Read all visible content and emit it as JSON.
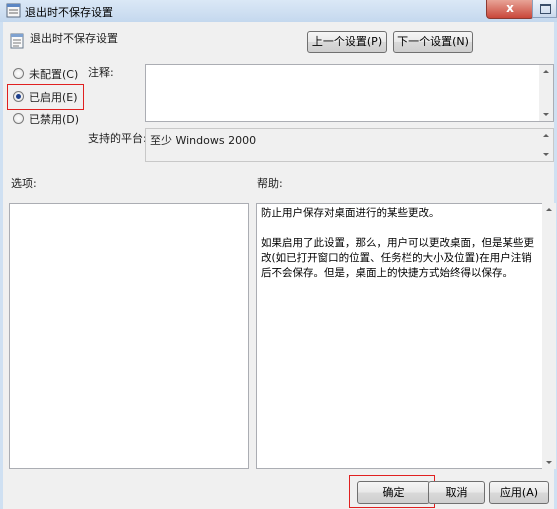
{
  "window": {
    "title": "退出时不保存设置",
    "close_label": "x"
  },
  "header": {
    "setting_title": "退出时不保存设置",
    "prev_button": "上一个设置(P)",
    "next_button": "下一个设置(N)"
  },
  "state": {
    "options": [
      {
        "label": "未配置(C)",
        "checked": false
      },
      {
        "label": "已启用(E)",
        "checked": true
      },
      {
        "label": "已禁用(D)",
        "checked": false
      }
    ]
  },
  "comment": {
    "label": "注释:",
    "value": ""
  },
  "platform": {
    "label": "支持的平台:",
    "value": "至少 Windows 2000"
  },
  "options_panel": {
    "label": "选项:"
  },
  "help_panel": {
    "label": "帮助:",
    "paragraphs": [
      "防止用户保存对桌面进行的某些更改。",
      "如果启用了此设置，那么，用户可以更改桌面，但是某些更改(如已打开窗口的位置、任务栏的大小及位置)在用户注销后不会保存。但是，桌面上的快捷方式始终得以保存。"
    ]
  },
  "footer": {
    "ok_button": "确定",
    "cancel_button": "取消",
    "apply_button": "应用(A)"
  },
  "colors": {
    "highlight_box": "#e02020",
    "close_button": "#c9473a"
  }
}
